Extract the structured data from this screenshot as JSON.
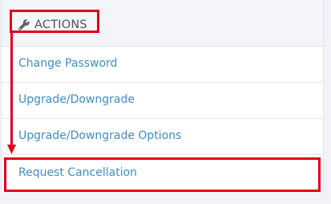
{
  "panel": {
    "header": {
      "icon": "wrench-icon",
      "title": "ACTIONS"
    },
    "items": [
      {
        "label": "Change Password"
      },
      {
        "label": "Upgrade/Downgrade"
      },
      {
        "label": "Upgrade/Downgrade Options"
      },
      {
        "label": "Request Cancellation"
      }
    ]
  },
  "annotation": {
    "color": "#e3001b"
  }
}
